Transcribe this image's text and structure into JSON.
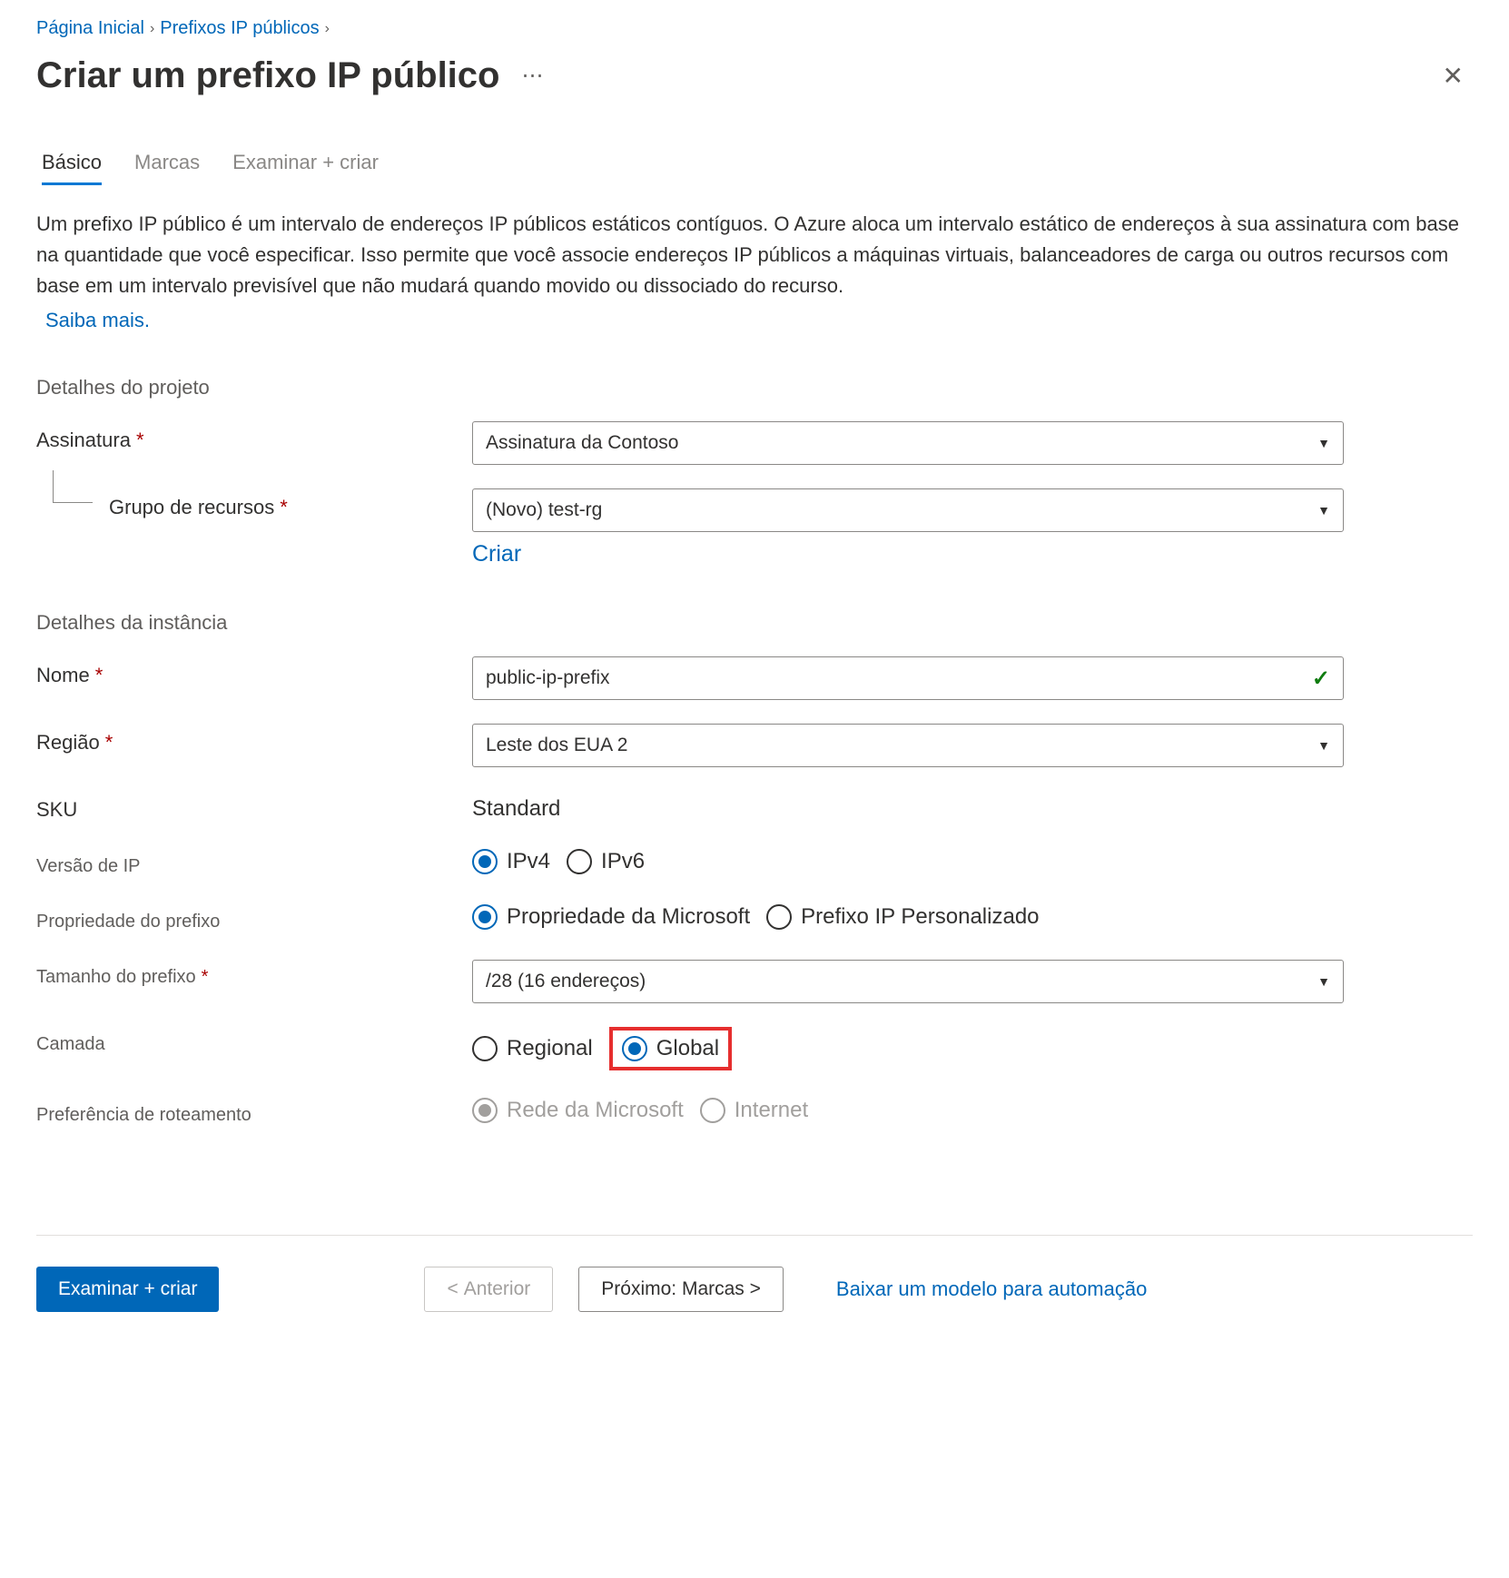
{
  "breadcrumb": {
    "home": "Página Inicial",
    "prefixes": "Prefixos IP públicos"
  },
  "page_title": "Criar um prefixo IP público",
  "tabs": {
    "basic": "Básico",
    "tags": "Marcas",
    "review": "Examinar + criar"
  },
  "intro_text": "Um prefixo IP público é um intervalo de endereços IP públicos estáticos contíguos. O Azure aloca um intervalo estático de endereços à sua assinatura com base na quantidade que você especificar. Isso permite que você associe endereços IP públicos a máquinas virtuais, balanceadores de carga ou outros recursos com base em um intervalo previsível que não mudará quando movido ou dissociado do recurso.",
  "learn_more": "Saiba mais.",
  "sections": {
    "project_details": "Detalhes do projeto",
    "instance_details": "Detalhes da instância"
  },
  "fields": {
    "subscription": {
      "label": "Assinatura",
      "value": "Assinatura da Contoso"
    },
    "resource_group": {
      "label": "Grupo de recursos",
      "value": "(Novo) test-rg",
      "create_new": "Criar"
    },
    "name": {
      "label": "Nome",
      "value": "public-ip-prefix"
    },
    "region": {
      "label": "Região",
      "value": "Leste dos EUA 2"
    },
    "sku": {
      "label": "SKU",
      "value": "Standard"
    },
    "ip_version": {
      "label": "Versão de IP",
      "options": {
        "ipv4": "IPv4",
        "ipv6": "IPv6"
      },
      "selected": "ipv4"
    },
    "prefix_ownership": {
      "label": "Propriedade do prefixo",
      "options": {
        "msft": "Propriedade da Microsoft",
        "custom": "Prefixo IP Personalizado"
      },
      "selected": "msft"
    },
    "prefix_size": {
      "label": "Tamanho do prefixo",
      "value": "/28 (16 endereços)"
    },
    "tier": {
      "label": "Camada",
      "options": {
        "regional": "Regional",
        "global": "Global"
      },
      "selected": "global"
    },
    "routing_pref": {
      "label": "Preferência de roteamento",
      "options": {
        "msft_net": "Rede da Microsoft",
        "internet": "Internet"
      },
      "selected": "msft_net"
    }
  },
  "footer": {
    "review_create": "Examinar + criar",
    "previous": "Anterior",
    "next": "Próximo: Marcas >",
    "download_template": "Baixar um modelo para automação"
  }
}
